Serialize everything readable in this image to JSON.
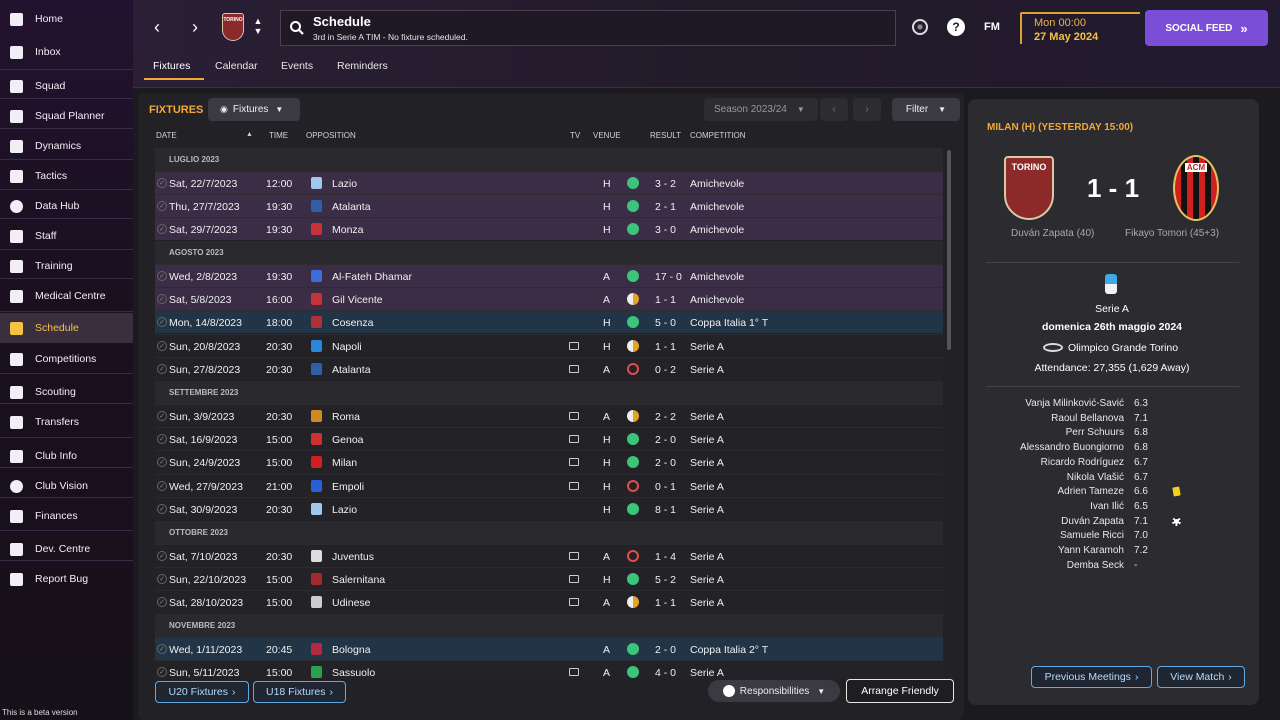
{
  "sidebar": {
    "items": [
      {
        "label": "Home",
        "icon": "home-icon",
        "name": "nav-home",
        "active": false
      },
      {
        "label": "Inbox",
        "icon": "inbox-icon",
        "name": "nav-inbox",
        "active": false
      },
      {
        "label": "Squad",
        "icon": "shirt-icon",
        "name": "nav-squad",
        "active": false
      },
      {
        "label": "Squad Planner",
        "icon": "clipboard-icon",
        "name": "nav-squad-planner",
        "active": false
      },
      {
        "label": "Dynamics",
        "icon": "people-icon",
        "name": "nav-dynamics",
        "active": false
      },
      {
        "label": "Tactics",
        "icon": "tactics-board-icon",
        "name": "nav-tactics",
        "active": false
      },
      {
        "label": "Data Hub",
        "icon": "data-hub-icon",
        "name": "nav-data-hub",
        "active": false
      },
      {
        "label": "Staff",
        "icon": "staff-icon",
        "name": "nav-staff",
        "active": false
      },
      {
        "label": "Training",
        "icon": "cone-icon",
        "name": "nav-training",
        "active": false
      },
      {
        "label": "Medical Centre",
        "icon": "medical-kit-icon",
        "name": "nav-medical-centre",
        "active": false
      },
      {
        "label": "Schedule",
        "icon": "calendar-icon",
        "name": "nav-schedule",
        "active": true
      },
      {
        "label": "Competitions",
        "icon": "trophy-icon",
        "name": "nav-competitions",
        "active": false
      },
      {
        "label": "Scouting",
        "icon": "magnifier-icon",
        "name": "nav-scouting",
        "active": false
      },
      {
        "label": "Transfers",
        "icon": "transfer-arrows-icon",
        "name": "nav-transfers",
        "active": false
      },
      {
        "label": "Club Info",
        "icon": "shield-icon",
        "name": "nav-club-info",
        "active": false
      },
      {
        "label": "Club Vision",
        "icon": "briefcase-icon",
        "name": "nav-club-vision",
        "active": false
      },
      {
        "label": "Finances",
        "icon": "money-icon",
        "name": "nav-finances",
        "active": false
      },
      {
        "label": "Dev. Centre",
        "icon": "dev-centre-icon",
        "name": "nav-dev-centre",
        "active": false
      },
      {
        "label": "Report Bug",
        "icon": "warning-icon",
        "name": "nav-report-bug",
        "active": false
      }
    ],
    "beta": "This is a beta version"
  },
  "topbar": {
    "title": "Schedule",
    "subtitle": "3rd in Serie A TIM - No fixture scheduled.",
    "fm": "FM",
    "time": "Mon 00:00",
    "date": "27 May 2024",
    "social": "SOCIAL FEED",
    "club_badge": "TORINO"
  },
  "tabs": [
    {
      "label": "Fixtures",
      "active": true
    },
    {
      "label": "Calendar",
      "active": false
    },
    {
      "label": "Events",
      "active": false
    },
    {
      "label": "Reminders",
      "active": false
    }
  ],
  "fixtures": {
    "heading": "FIXTURES",
    "filter": "Fixtures",
    "season": "Season 2023/24",
    "filter_btn": "Filter",
    "columns": {
      "date": "DATE",
      "time": "TIME",
      "opposition": "OPPOSITION",
      "tv": "TV",
      "venue": "VENUE",
      "result": "RESULT",
      "competition": "COMPETITION"
    },
    "months": [
      "LUGLIO 2023",
      "AGOSTO 2023",
      "SETTEMBRE 2023",
      "OTTOBRE 2023",
      "NOVEMBRE 2023"
    ],
    "rows": [
      {
        "date": "Sat, 22/7/2023",
        "time": "12:00",
        "opp": "Lazio",
        "tv": false,
        "venue": "H",
        "res": "w",
        "score": "3 - 2",
        "comp": "Amichevole",
        "crest": "#9ec9ea",
        "bg": "#3a2d45"
      },
      {
        "date": "Thu, 27/7/2023",
        "time": "19:30",
        "opp": "Atalanta",
        "tv": false,
        "venue": "H",
        "res": "w",
        "score": "2 - 1",
        "comp": "Amichevole",
        "crest": "#2f5fa8",
        "bg": "#3a2d45"
      },
      {
        "date": "Sat, 29/7/2023",
        "time": "19:30",
        "opp": "Monza",
        "tv": false,
        "venue": "H",
        "res": "w",
        "score": "3 - 0",
        "comp": "Amichevole",
        "crest": "#c8323a",
        "bg": "#3a2d45"
      },
      {
        "date": "Wed, 2/8/2023",
        "time": "19:30",
        "opp": "Al-Fateh Dhamar",
        "tv": false,
        "venue": "A",
        "res": "w",
        "score": "17 - 0",
        "comp": "Amichevole",
        "crest": "#3a6fd8",
        "bg": "#3a2d45"
      },
      {
        "date": "Sat, 5/8/2023",
        "time": "16:00",
        "opp": "Gil Vicente",
        "tv": false,
        "venue": "A",
        "res": "d",
        "score": "1 - 1",
        "comp": "Amichevole",
        "crest": "#c8323a",
        "bg": "#3a2d45"
      },
      {
        "date": "Mon, 14/8/2023",
        "time": "18:00",
        "opp": "Cosenza",
        "tv": false,
        "venue": "H",
        "res": "w",
        "score": "5 - 0",
        "comp": "Coppa Italia 1° T",
        "crest": "#b0303a",
        "bg": "#213547"
      },
      {
        "date": "Sun, 20/8/2023",
        "time": "20:30",
        "opp": "Napoli",
        "tv": true,
        "venue": "H",
        "res": "d",
        "score": "1 - 1",
        "comp": "Serie A",
        "crest": "#2a86d8",
        "bg": "#232327"
      },
      {
        "date": "Sun, 27/8/2023",
        "time": "20:30",
        "opp": "Atalanta",
        "tv": true,
        "venue": "A",
        "res": "l",
        "score": "0 - 2",
        "comp": "Serie A",
        "crest": "#2f5fa8",
        "bg": "#232327"
      },
      {
        "date": "Sun, 3/9/2023",
        "time": "20:30",
        "opp": "Roma",
        "tv": true,
        "venue": "A",
        "res": "d",
        "score": "2 - 2",
        "comp": "Serie A",
        "crest": "#d08a20",
        "bg": "#232327"
      },
      {
        "date": "Sat, 16/9/2023",
        "time": "15:00",
        "opp": "Genoa",
        "tv": true,
        "venue": "H",
        "res": "w",
        "score": "2 - 0",
        "comp": "Serie A",
        "crest": "#d03030",
        "bg": "#232327"
      },
      {
        "date": "Sun, 24/9/2023",
        "time": "15:00",
        "opp": "Milan",
        "tv": true,
        "venue": "H",
        "res": "w",
        "score": "2 - 0",
        "comp": "Serie A",
        "crest": "#d02020",
        "bg": "#232327"
      },
      {
        "date": "Wed, 27/9/2023",
        "time": "21:00",
        "opp": "Empoli",
        "tv": true,
        "venue": "H",
        "res": "l",
        "score": "0 - 1",
        "comp": "Serie A",
        "crest": "#2a5fd8",
        "bg": "#232327"
      },
      {
        "date": "Sat, 30/9/2023",
        "time": "20:30",
        "opp": "Lazio",
        "tv": false,
        "venue": "H",
        "res": "w",
        "score": "8 - 1",
        "comp": "Serie A",
        "crest": "#9ec9ea",
        "bg": "#232327"
      },
      {
        "date": "Sat, 7/10/2023",
        "time": "20:30",
        "opp": "Juventus",
        "tv": true,
        "venue": "A",
        "res": "l",
        "score": "1 - 4",
        "comp": "Serie A",
        "crest": "#dddddd",
        "bg": "#232327"
      },
      {
        "date": "Sun, 22/10/2023",
        "time": "15:00",
        "opp": "Salernitana",
        "tv": true,
        "venue": "H",
        "res": "w",
        "score": "5 - 2",
        "comp": "Serie A",
        "crest": "#a02a30",
        "bg": "#232327"
      },
      {
        "date": "Sat, 28/10/2023",
        "time": "15:00",
        "opp": "Udinese",
        "tv": true,
        "venue": "A",
        "res": "d",
        "score": "1 - 1",
        "comp": "Serie A",
        "crest": "#cccccc",
        "bg": "#232327"
      },
      {
        "date": "Wed, 1/11/2023",
        "time": "20:45",
        "opp": "Bologna",
        "tv": false,
        "venue": "A",
        "res": "w",
        "score": "2 - 0",
        "comp": "Coppa Italia 2° T",
        "crest": "#b02a40",
        "bg": "#213547"
      },
      {
        "date": "Sun, 5/11/2023",
        "time": "15:00",
        "opp": "Sassuolo",
        "tv": true,
        "venue": "A",
        "res": "w",
        "score": "4 - 0",
        "comp": "Serie A",
        "crest": "#2aa050",
        "bg": "#232327"
      }
    ],
    "buttons": {
      "u20": "U20 Fixtures",
      "u18": "U18 Fixtures",
      "responsibilities": "Responsibilities",
      "arrange": "Arrange Friendly"
    }
  },
  "match": {
    "heading": "MILAN (H) (YESTERDAY 15:00)",
    "score": "1 - 1",
    "home_badge": "TORINO",
    "away_badge": "ACM",
    "home_scorer": "Duván Zapata (40)",
    "away_scorer": "Fikayo Tomori (45+3)",
    "competition": "Serie A",
    "date": "domenica 26th maggio 2024",
    "stadium": "Olimpico Grande Torino",
    "attendance": "Attendance: 27,355 (1,629 Away)",
    "players": [
      {
        "name": "Vanja Milinković-Savić",
        "rating": "6.3",
        "mark": ""
      },
      {
        "name": "Raoul Bellanova",
        "rating": "7.1",
        "mark": ""
      },
      {
        "name": "Perr Schuurs",
        "rating": "6.8",
        "mark": ""
      },
      {
        "name": "Alessandro Buongiorno",
        "rating": "6.8",
        "mark": ""
      },
      {
        "name": "Ricardo Rodríguez",
        "rating": "6.7",
        "mark": ""
      },
      {
        "name": "Nikola Vlašić",
        "rating": "6.7",
        "mark": ""
      },
      {
        "name": "Adrien Tameze",
        "rating": "6.6",
        "mark": "yellow"
      },
      {
        "name": "Ivan Ilić",
        "rating": "6.5",
        "mark": ""
      },
      {
        "name": "Duván Zapata",
        "rating": "7.1",
        "mark": "goal"
      },
      {
        "name": "Samuele Ricci",
        "rating": "7.0",
        "mark": ""
      },
      {
        "name": "Yann Karamoh",
        "rating": "7.2",
        "mark": ""
      },
      {
        "name": "Demba Seck",
        "rating": "-",
        "mark": ""
      }
    ],
    "prev_btn": "Previous Meetings",
    "view_btn": "View Match"
  }
}
